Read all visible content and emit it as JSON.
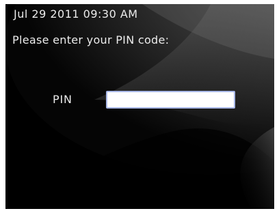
{
  "screen": {
    "timestamp": "Jul 29 2011 09:30 AM",
    "prompt": "Please enter your PIN code:",
    "pin_label": "PIN",
    "pin_value": "",
    "pin_placeholder": ""
  },
  "colors": {
    "background": "#000000",
    "text": "#ececec",
    "input_border": "#a9b8e8",
    "input_fill": "#ffffff"
  }
}
